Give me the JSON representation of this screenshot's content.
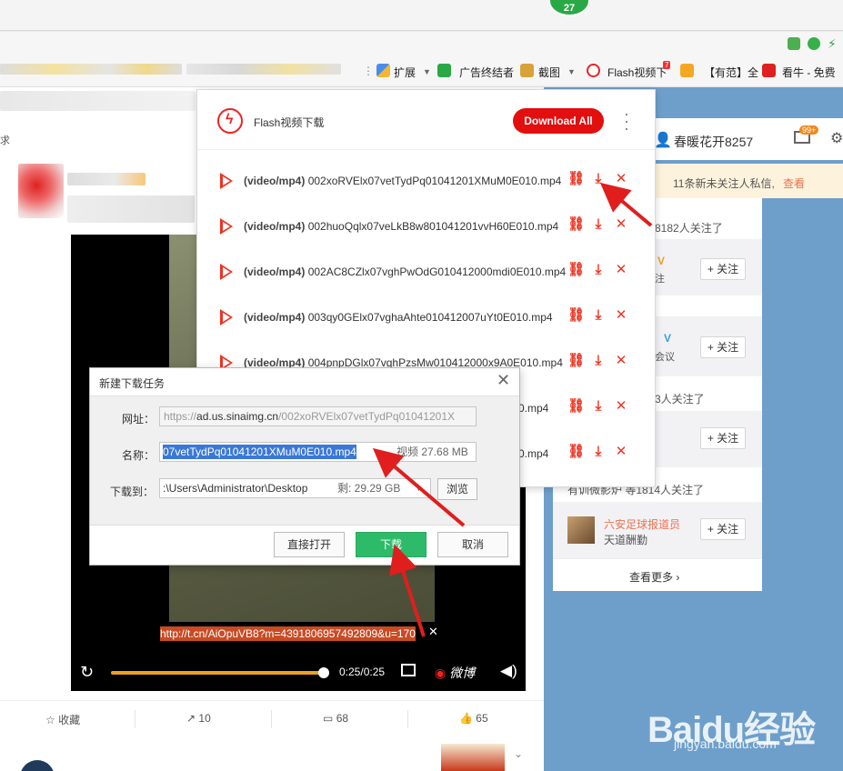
{
  "browser": {
    "badge_count": "27",
    "bookmarks": {
      "extensions": "扩展",
      "adblock": "广告终结者",
      "screenshot": "截图",
      "flash": "Flash视频下",
      "flash_badge": "7",
      "youfan": "【有范】全",
      "kanniu": "看牛 - 免费"
    }
  },
  "weibo": {
    "user_name": "春暖花开8257",
    "mail_badge": "99+",
    "notice": "11条新未关注人私信,",
    "notice_link": "查看",
    "side_lines": [
      "8182人关注了",
      "注",
      "会议",
      "3人关注了",
      "有训微影炉 等1814人关注了"
    ],
    "follow_label": "+ 关注",
    "recommend": {
      "name": "六安足球报道员",
      "desc": "天道酬勤"
    },
    "see_more": "查看更多 ›",
    "search_fragment": "求",
    "actions": {
      "favorite": "收藏",
      "repost": "10",
      "comment": "68",
      "like": "65"
    }
  },
  "video": {
    "time": "0:25/0:25",
    "url_overlay": "http://t.cn/AiOpuVB8?m=4391806957492809&u=170",
    "weibo_mark": "微博"
  },
  "flash_panel": {
    "title": "Flash视频下载",
    "download_all": "Download All",
    "rows": [
      {
        "type": "(video/mp4)",
        "name": "002xoRVElx07vetTydPq01041201XMuM0E010.mp4"
      },
      {
        "type": "(video/mp4)",
        "name": "002huoQqlx07veLkB8w801041201vvH60E010.mp4"
      },
      {
        "type": "(video/mp4)",
        "name": "002AC8CZlx07vghPwOdG010412000mdi0E010.mp4"
      },
      {
        "type": "(video/mp4)",
        "name": "003qy0GElx07vghaAhte010412007uYt0E010.mp4"
      },
      {
        "type": "(video/mp4)",
        "name": "004pnpDGlx07vghPzsMw010412000x9A0E010.mp4"
      },
      {
        "type": "",
        "name": "0.mp4"
      },
      {
        "type": "",
        "name": "0.mp4"
      }
    ]
  },
  "dialog": {
    "title": "新建下载任务",
    "url_label": "网址：",
    "url_prefix": "https://",
    "url_host": "ad.us.sinaimg.cn",
    "url_path": "/002xoRVElx07vetTydPq01041201X",
    "name_label": "名称：",
    "name_value": "07vetTydPq01041201XMuM0E010.mp4",
    "name_info": "视频 27.68 MB",
    "path_label": "下载到：",
    "path_value": ":\\Users\\Administrator\\Desktop",
    "path_free": "剩: 29.29 GB",
    "browse": "浏览",
    "open_direct": "直接打开",
    "download": "下载",
    "cancel": "取消"
  },
  "watermark": {
    "main": "Baidu经验",
    "sub": "jingyan.baidu.com"
  },
  "colors": {
    "accent_red": "#e30e0e",
    "dialog_green": "#2dbb6a",
    "selection_blue": "#3a78d8",
    "weibo_blue": "#6e9fcb"
  }
}
